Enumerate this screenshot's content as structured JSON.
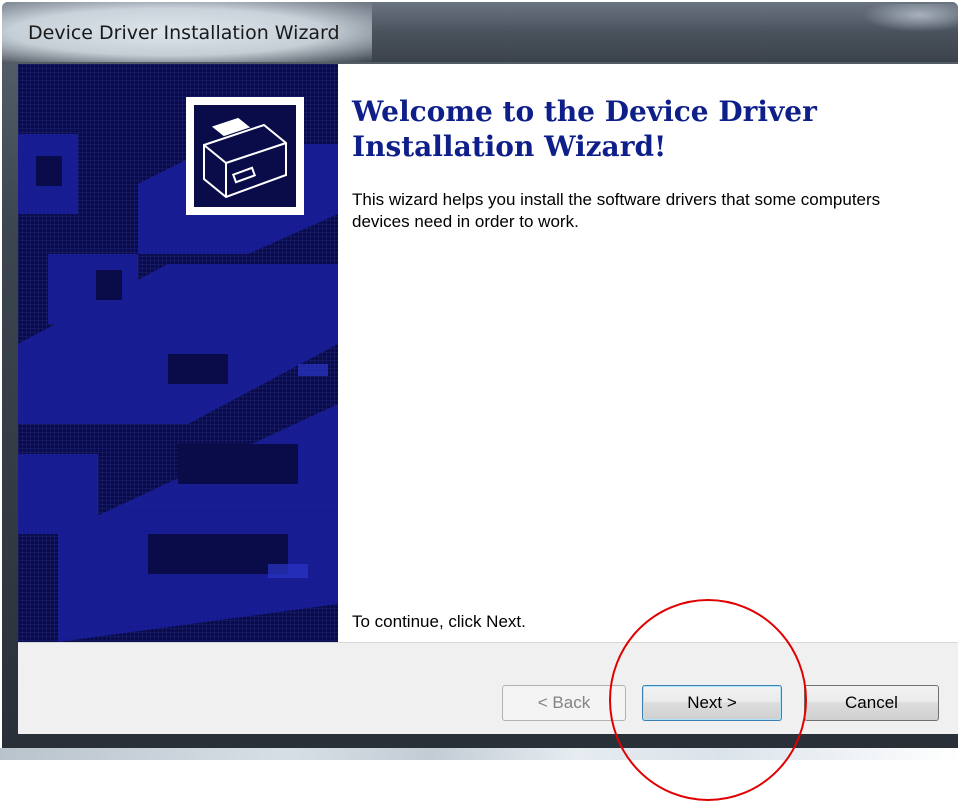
{
  "window": {
    "title": "Device Driver Installation Wizard"
  },
  "wizard": {
    "heading": "Welcome to the Device Driver Installation Wizard!",
    "description": "This wizard helps you install the software drivers that some computers devices need in order to work.",
    "continue_hint": "To continue, click Next."
  },
  "buttons": {
    "back_label": "< Back",
    "back_enabled": false,
    "next_label": "Next >",
    "cancel_label": "Cancel"
  },
  "colors": {
    "banner": "#0a0c4a",
    "heading": "#0e1f8a",
    "annotation": "#e00000"
  },
  "icons": {
    "wizard": "hardware-drive-icon",
    "annotation": "red-circle-highlight"
  }
}
